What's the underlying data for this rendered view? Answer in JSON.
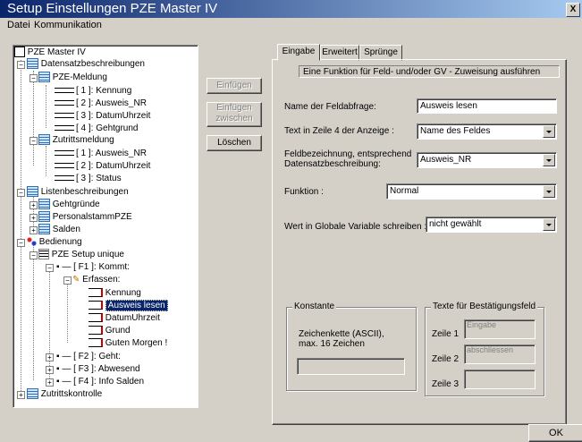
{
  "window": {
    "title": "Setup Einstellungen PZE Master IV",
    "close_glyph": "X"
  },
  "menu": [
    "Datei",
    "Kommunikation"
  ],
  "tree": {
    "root": "PZE Master IV",
    "datensatz": "Datensatzbeschreibungen",
    "pze_meldung": "PZE-Meldung",
    "pze_fields": [
      "[ 1 ]: Kennung",
      "[ 2 ]: Ausweis_NR",
      "[ 3 ]: DatumUhrzeit",
      "[ 4 ]: Gehtgrund"
    ],
    "zutritt": "Zutrittsmeldung",
    "zutritt_fields": [
      "[ 1 ]: Ausweis_NR",
      "[ 2 ]: DatumUhrzeit",
      "[ 3 ]: Status"
    ],
    "listen": "Listenbeschreibungen",
    "listen_items": [
      "Gehtgründe",
      "PersonalstammPZE",
      "Salden"
    ],
    "bedienung": "Bedienung",
    "setup": "PZE Setup unique",
    "f1": "[ F1 ]: Kommt:",
    "erfassen": "Erfassen:",
    "erfassen_items": [
      "Kennung",
      "Ausweis lesen",
      "DatumUhrzeit",
      "Grund",
      "Guten Morgen !"
    ],
    "selected": "Ausweis lesen",
    "f_keys": [
      "[ F2 ]: Geht:",
      "[ F3 ]: Abwesend",
      "[ F4 ]: Info Salden"
    ],
    "zutrittskontrolle": "Zutrittskontrolle"
  },
  "buttons": {
    "einfuegen": "Einfügen",
    "einfuegen_zwischen_1": "Einfügen",
    "einfuegen_zwischen_2": "zwischen",
    "loeschen": "Löschen",
    "ok": "OK"
  },
  "tabs": [
    "Eingabe",
    "Erweitert",
    "Sprünge"
  ],
  "form": {
    "header": "Eine Funktion für Feld- und/oder GV - Zuweisung ausführen",
    "name_label": "Name der Feldabfrage:",
    "name_value": "Ausweis lesen",
    "text_label": "Text in Zeile 4 der Anzeige :",
    "text_value": "Name des Feldes",
    "feld_label_1": "Feldbezeichnung, entsprechend",
    "feld_label_2": "Datensatzbeschreibung:",
    "feld_value": "Ausweis_NR",
    "funktion_label": "Funktion :",
    "funktion_value": "Normal",
    "gv_label": "Wert in Globale Variable schreiben :",
    "gv_value": "nicht gewählt"
  },
  "konstante": {
    "title": "Konstante",
    "desc_1": "Zeichenkette (ASCII),",
    "desc_2": "max. 16 Zeichen"
  },
  "bestaetigung": {
    "title": "Texte für Bestätigungsfeld",
    "zeile1_label": "Zeile 1",
    "zeile1_value": "Eingabe",
    "zeile2_label": "Zeile 2",
    "zeile2_value": "abschliessen",
    "zeile3_label": "Zeile 3"
  },
  "colors": {
    "title_start": "#0a246a",
    "title_end": "#a6caf0",
    "selection": "#0a246a",
    "face": "#d4d0c8"
  }
}
